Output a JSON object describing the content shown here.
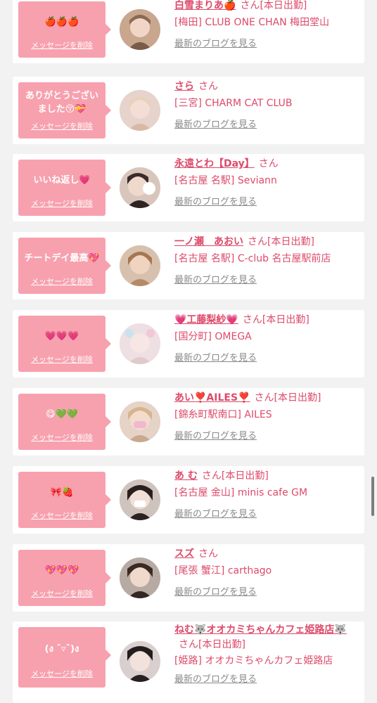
{
  "delete_label": "メッセージを削除",
  "blog_label": "最新のブログを見る",
  "san": "さん",
  "colors": {
    "accent": "#dd4a6a",
    "bubble": "#f7a1ae",
    "background": "#f2f2f2"
  },
  "entries": [
    {
      "message": "🍎🍎🍎",
      "name": "白雪まりあ🍎",
      "today": "[本日出勤]",
      "shop": "[梅田] CLUB ONE CHAN 梅田堂山"
    },
    {
      "message": "ありがとうございました😚💝",
      "name": "さら",
      "today": "",
      "shop": "[三宮] CHARM CAT CLUB"
    },
    {
      "message": "いいね返し💗",
      "name": "永遠とわ【Day】",
      "today": "",
      "shop": "[名古屋 名駅] Seviann"
    },
    {
      "message": "チートデイ最高💖",
      "name": "一ノ瀬　あおい",
      "today": "[本日出勤]",
      "shop": "[名古屋 名駅] C-club 名古屋駅前店"
    },
    {
      "message": "💗💗💗",
      "name": "💗工藤梨紗💗",
      "today": "[本日出勤]",
      "shop": "[国分町] OMEGA"
    },
    {
      "message": "😋💚💚",
      "name": "あい❣️AILES❣️",
      "today": "[本日出勤]",
      "shop": "[錦糸町駅南口] AILES"
    },
    {
      "message": "🎀🍓",
      "name": "あ む",
      "today": "[本日出勤]",
      "shop": "[名古屋 金山] minis cafe GM"
    },
    {
      "message": "💖💖💖",
      "name": "スズ",
      "today": "",
      "shop": "[尾張 蟹江] carthago"
    },
    {
      "message": "(ง ˆ▿ˆ)ง",
      "name": "ねむ🐺オオカミちゃんカフェ姫路店🐺",
      "today": "[本日出勤]",
      "shop": "[姫路] オオカミちゃんカフェ姫路店"
    }
  ]
}
